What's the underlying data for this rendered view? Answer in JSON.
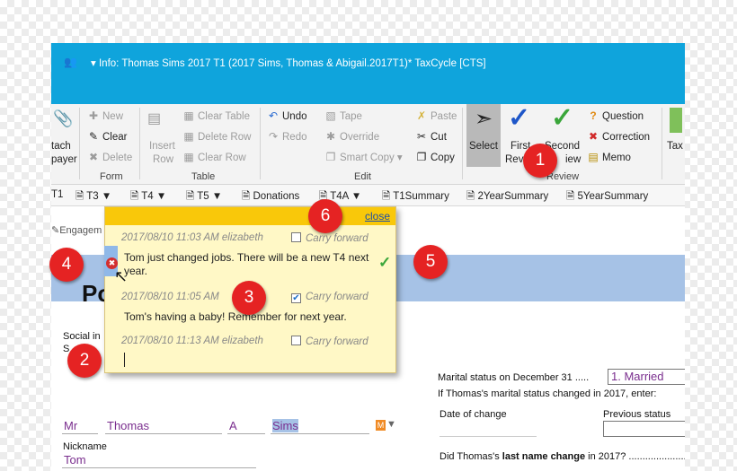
{
  "window": {
    "title": "Info: Thomas Sims 2017 T1 (2017 Sims, Thomas & Abigail.2017T1)* TaxCycle [CTS]"
  },
  "ribbon": {
    "attach_taxpayer": [
      "tach",
      "payer"
    ],
    "form": {
      "label": "Form",
      "new": "New",
      "clear": "Clear",
      "delete": "Delete"
    },
    "table": {
      "label": "Table",
      "insert_row": [
        "Insert",
        "Row"
      ],
      "clear_table": "Clear Table",
      "delete_row": "Delete Row",
      "clear_row": "Clear Row"
    },
    "edit": {
      "label": "Edit",
      "undo": "Undo",
      "redo": "Redo",
      "tape": "Tape",
      "override": "Override",
      "smart_copy": "Smart Copy",
      "paste": "Paste",
      "cut": "Cut",
      "copy": "Copy"
    },
    "review": {
      "label": "Review",
      "select": "Select",
      "first_review": [
        "First",
        "Rev"
      ],
      "second_review": [
        "Second",
        "iew"
      ],
      "question": "Question",
      "correction": "Correction",
      "memo": "Memo"
    },
    "tax": "Tax"
  },
  "tabs": [
    "T1",
    "T3",
    "T4",
    "T5",
    "Donations",
    "T4A",
    "T1Summary",
    "2YearSummary",
    "5YearSummary"
  ],
  "content": {
    "engagement": "Engagem",
    "section_prefix": "Po",
    "social_insurance": [
      "Social in",
      "S"
    ],
    "title_value": "Mr",
    "first_name": "Thomas",
    "initial": "A",
    "last_name": "Sims",
    "nickname_label": "Nickname",
    "nickname_value": "Tom",
    "marital_label": "Marital status on December 31 .....",
    "marital_value": "1. Married",
    "marital_changed": "If Thomas's marital status changed in 2017, enter:",
    "date_of_change": "Date of change",
    "previous_status": "Previous status",
    "last_name_q_pre": "Did Thomas's ",
    "last_name_q_bold": "last name change",
    "last_name_q_post": " in 2017?  ......................"
  },
  "memo": {
    "close": "close",
    "carry_forward": "Carry forward",
    "entries": [
      {
        "meta": "2017/08/10 11:03 AM elizabeth",
        "carry": false,
        "text": "Tom just changed jobs. There will be a new T4 next year."
      },
      {
        "meta": "2017/08/10 11:05 AM",
        "carry": true,
        "text": "Tom's having a baby! Remember for next year."
      },
      {
        "meta": "2017/08/10 11:13 AM elizabeth",
        "carry": false,
        "text": ""
      }
    ]
  },
  "callouts": [
    "1",
    "2",
    "3",
    "4",
    "5",
    "6"
  ],
  "colors": {
    "titlebar": "#0fa4dc",
    "memo_header": "#f9c80a",
    "memo_bg": "#fff8c6",
    "callout": "#e52323",
    "field_text": "#7a2e8e",
    "review_check_blue": "#1e56c8",
    "review_check_green": "#3aa63a"
  }
}
